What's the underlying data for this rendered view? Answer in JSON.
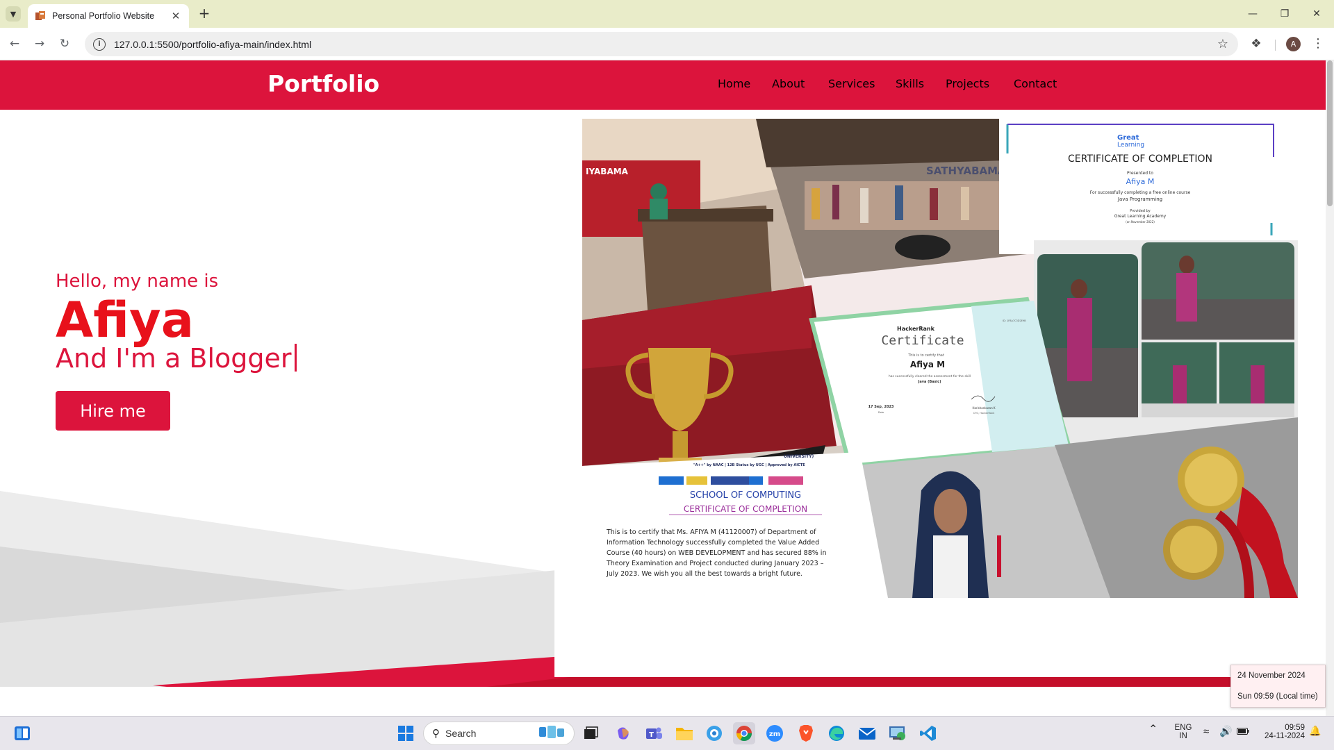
{
  "browser": {
    "tab_title": "Personal Portfolio Website",
    "url": "127.0.0.1:5500/portfolio-afiya-main/index.html",
    "profile_initial": "A"
  },
  "site": {
    "logo": "Portfolio",
    "nav": [
      "Home",
      "About",
      "Services",
      "Skills",
      "Projects",
      "Contact"
    ],
    "hero": {
      "greeting": "Hello, my name is",
      "name": "Afiya",
      "role_prefix": "And I'm a ",
      "role": "Blogger",
      "button": "Hire me"
    },
    "collage": {
      "tile_stage": {
        "banner": "IYABAMA",
        "sub": "SATHYABAMA"
      },
      "tile_great_learning": {
        "brand_line1": "Great",
        "brand_line2": "Learning",
        "title": "CERTIFICATE OF COMPLETION",
        "presented": "Presented to",
        "name": "Afiya M",
        "line1": "For successfully completing a free online course",
        "course": "Java Programming",
        "provided": "Provided by",
        "academy": "Great Learning Academy",
        "date": "(on November 2022)"
      },
      "tile_hackerrank": {
        "brand": "HackerRank",
        "title": "Certificate",
        "certify": "This is to certify that",
        "name": "Afiya M",
        "line": "has successfully cleared the assessment for the skill",
        "skill": "Java (Basic)",
        "date": "17 Sep, 2023",
        "date_label": "Date",
        "signer": "Harishankaran K",
        "signer_role": "CTO, HackerRank",
        "cert_id": "ID: 1F8A7C3D2E9B"
      },
      "tile_school_cert": {
        "header1": "UNIVERSITY)",
        "header2": "\"A++\" by NAAC | 12B Status by UGC | Approved by AICTE",
        "school": "SCHOOL OF COMPUTING",
        "title": "CERTIFICATE OF COMPLETION",
        "body": [
          "This is to certify that Ms. AFIYA M (41120007) of Department of",
          "Information Technology successfully completed the Value Added",
          "Course (40 hours) on WEB DEVELOPMENT and has secured 88% in",
          "Theory Examination and Project conducted during January 2023 –",
          "July 2023. We wish you all the best towards a bright future."
        ]
      }
    }
  },
  "system": {
    "popup_date": "24 November 2024",
    "popup_time": "Sun 09:59 (Local time)",
    "search_placeholder": "Search",
    "lang_top": "ENG",
    "lang_bottom": "IN",
    "clock_time": "09:59",
    "clock_date": "24-11-2024"
  },
  "colors": {
    "brand": "#dc143c",
    "name_red": "#e8111b",
    "tab_strip": "#e9ecc9"
  }
}
